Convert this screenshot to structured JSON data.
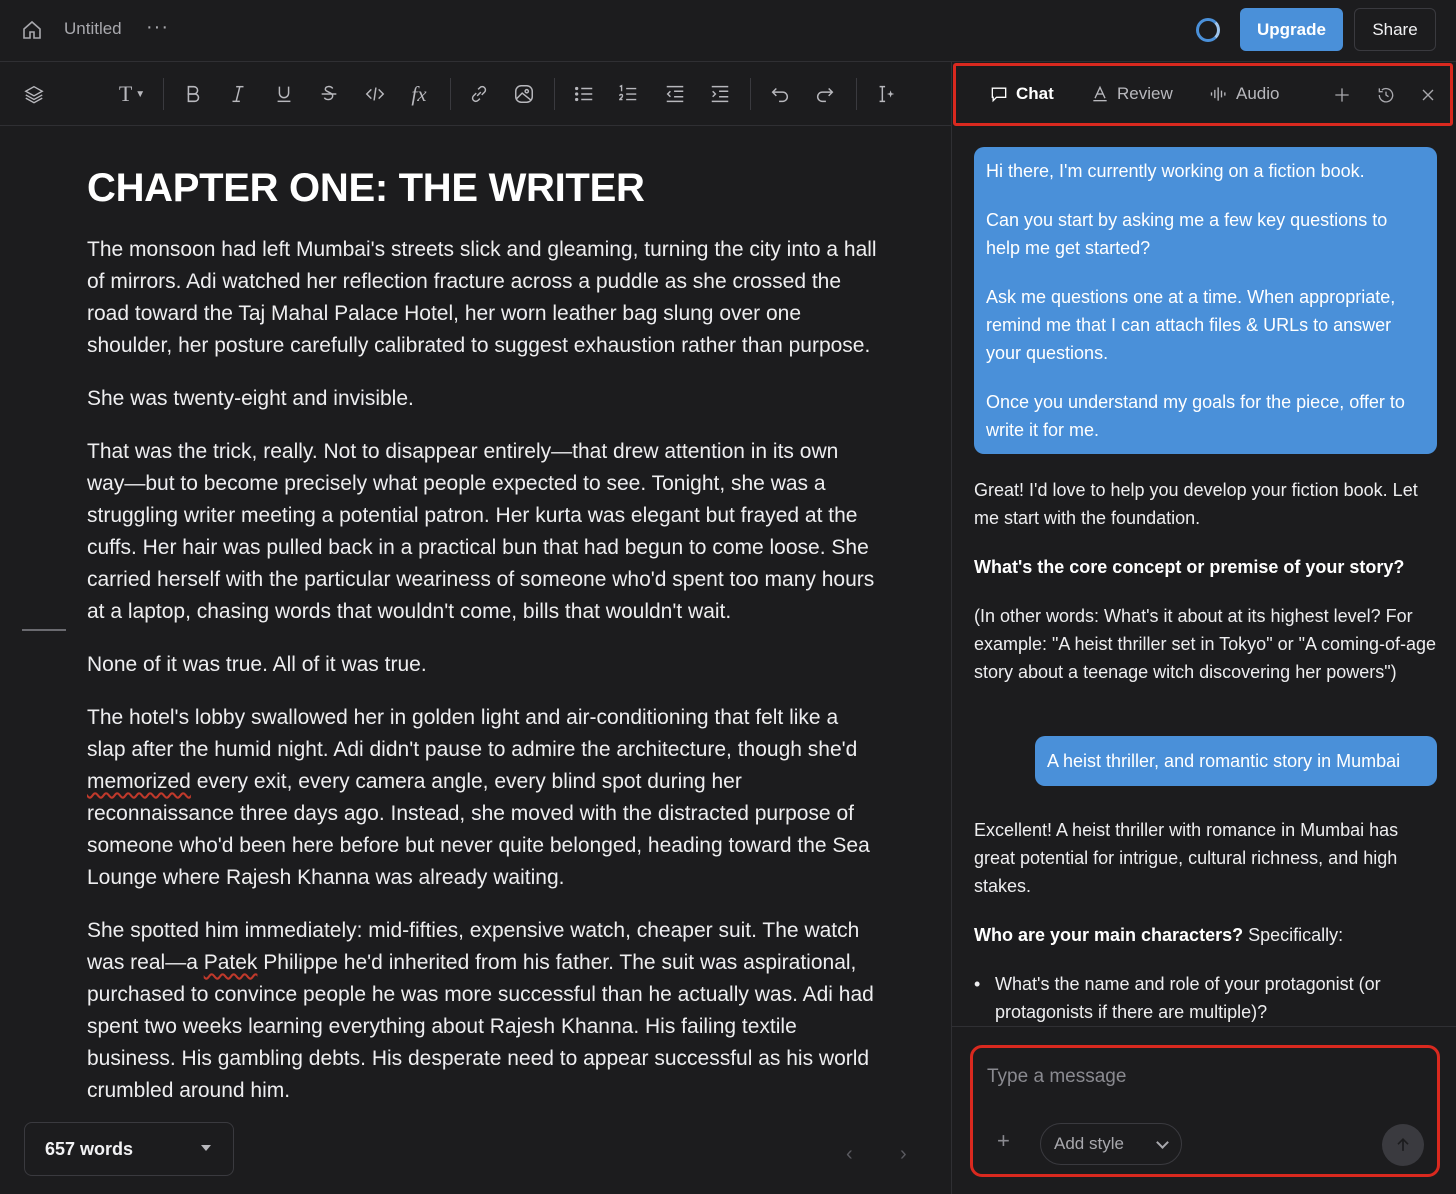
{
  "topbar": {
    "title": "Untitled",
    "more": "···",
    "upgrade_label": "Upgrade",
    "share_label": "Share"
  },
  "colors": {
    "accent": "#4a90d9",
    "highlight_box": "#d9291f",
    "background": "#1c1c1e"
  },
  "toolbar": {
    "icons": [
      "layers-icon",
      "text-style-icon",
      "bold-icon",
      "italic-icon",
      "underline-icon",
      "strikethrough-icon",
      "code-icon",
      "formula-icon",
      "link-icon",
      "image-icon",
      "bullet-list-icon",
      "numbered-list-icon",
      "outdent-icon",
      "indent-icon",
      "undo-icon",
      "redo-icon",
      "ai-cursor-icon"
    ]
  },
  "editor": {
    "chapter_title": "CHAPTER ONE: THE WRITER",
    "paragraphs": [
      "The monsoon had left Mumbai's streets slick and gleaming, turning the city into a hall of mirrors. Adi watched her reflection fracture across a puddle as she crossed the road toward the Taj Mahal Palace Hotel, her worn leather bag slung over one shoulder, her posture carefully calibrated to suggest exhaustion rather than purpose.",
      "She was twenty-eight and invisible.",
      "That was the trick, really. Not to disappear entirely—that drew attention in its own way—but to become precisely what people expected to see. Tonight, she was a struggling writer meeting a potential patron. Her kurta was elegant but frayed at the cuffs. Her hair was pulled back in a practical bun that had begun to come loose. She carried herself with the particular weariness of someone who'd spent too many hours at a laptop, chasing words that wouldn't come, bills that wouldn't wait.",
      "None of it was true. All of it was true.",
      "The hotel's lobby swallowed her in golden light and air-conditioning that felt like a slap after the humid night. Adi didn't pause to admire the architecture, though she'd memorized every exit, every camera angle, every blind spot during her reconnaissance three days ago. Instead, she moved with the distracted purpose of someone who'd been here before but never quite belonged, heading toward the Sea Lounge where Rajesh Khanna was already waiting."
    ],
    "p6_parts": {
      "a": "She spotted him immediately: mid-fifties, expensive watch, cheaper suit. The watch was real—a ",
      "b": "Patek",
      "c": " Philippe he'd inherited from his father. The suit was aspirational, purchased to convince people he was more successful than he actually was. Adi had spent two weeks learning everything about Rajesh Khanna. His failing textile business. His gambling debts. His desperate need to appear successful as his world crumbled around him."
    },
    "p5_parts": {
      "a": "The hotel's lobby swallowed her in golden light and air-conditioning that felt like a slap after the humid night. Adi didn't pause to admire the architecture, though she'd ",
      "b": "memorized",
      "c": " every exit, every camera angle, every blind spot during her reconnaissance three days ago. Instead, she moved with the distracted purpose of someone who'd been here before but never quite belonged, heading toward the Sea Lounge where Rajesh Khanna was already waiting."
    },
    "word_count": "657 words"
  },
  "panel": {
    "tabs": [
      {
        "label": "Chat",
        "icon": "chat-bubble-icon",
        "active": true
      },
      {
        "label": "Review",
        "icon": "review-icon",
        "active": false
      },
      {
        "label": "Audio",
        "icon": "audio-wave-icon",
        "active": false
      }
    ],
    "actions": [
      "plus-icon",
      "history-icon",
      "close-icon"
    ],
    "messages": {
      "user1": [
        "Hi there, I'm currently working on a fiction book.",
        "Can you start by asking me a few key questions to help me get started?",
        "Ask me questions one at a time. When appropriate, remind me that I can attach files & URLs to answer your questions.",
        "Once you understand my goals for the piece, offer to write it for me."
      ],
      "assistant1": {
        "intro": "Great! I'd love to help you develop your fiction book. Let me start with the foundation.",
        "question": "What's the core concept or premise of your story?",
        "detail": "(In other words: What's it about at its highest level? For example: \"A heist thriller set in Tokyo\" or \"A coming-of-age story about a teenage witch discovering her powers\")"
      },
      "user2": "A heist thriller, and romantic story in Mumbai",
      "assistant2": {
        "intro": "Excellent! A heist thriller with romance in Mumbai has great potential for intrigue, cultural richness, and high stakes.",
        "question_bold": "Who are your main characters?",
        "question_rest": " Specifically:",
        "bullets": [
          "What's the name and role of your protagonist (or protagonists if there are multiple)?"
        ]
      }
    },
    "composer": {
      "placeholder": "Type a message",
      "add_style_label": "Add style"
    }
  }
}
